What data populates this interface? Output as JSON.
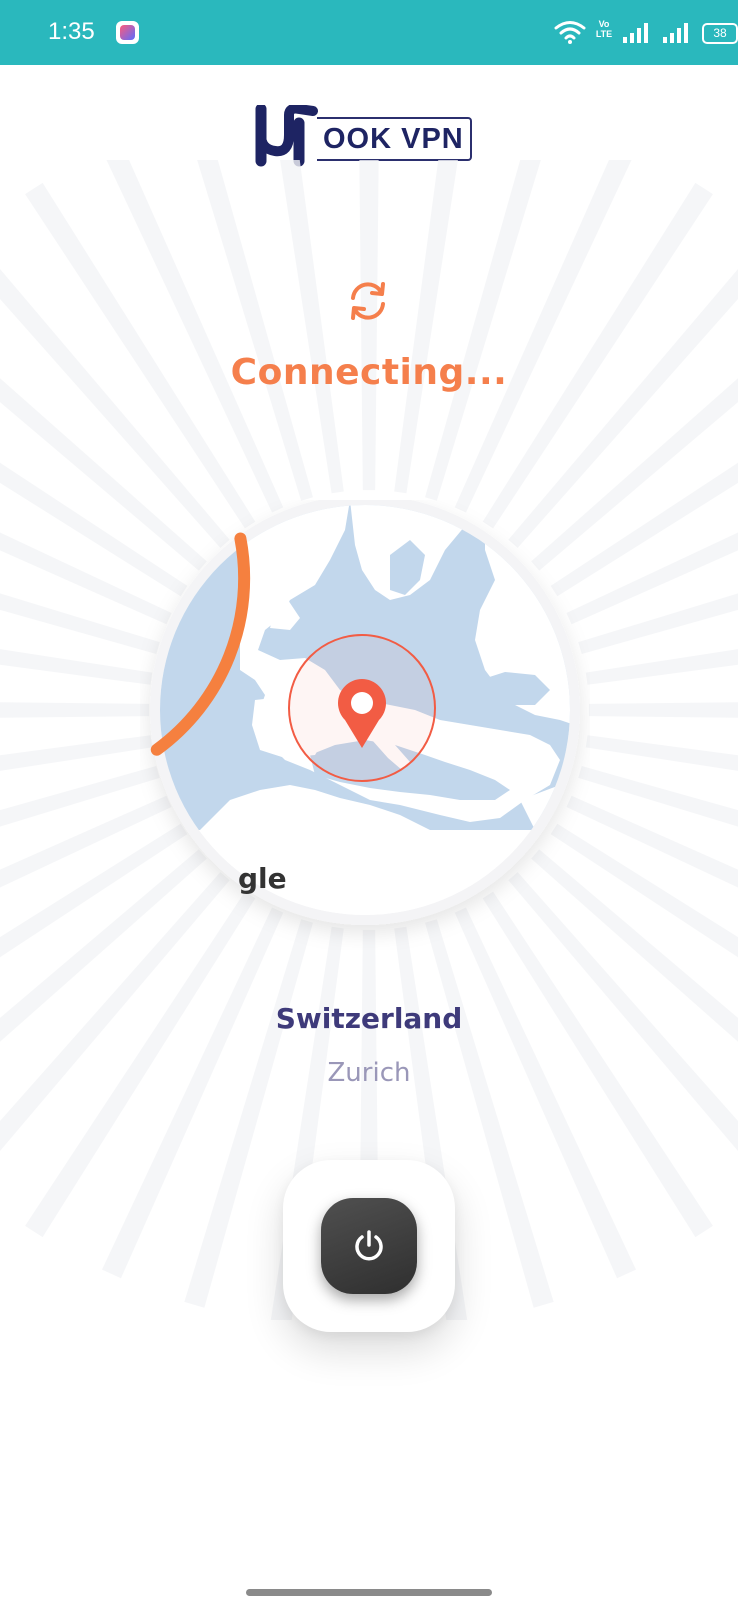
{
  "status_bar": {
    "time": "1:35",
    "volte_line1": "Vo",
    "volte_line2": "LTE",
    "battery": "38",
    "bg_color": "#2ab8bd"
  },
  "logo": {
    "text": "OOK VPN"
  },
  "connection": {
    "status": "Connecting...",
    "status_icon": "sync-icon",
    "accent_color": "#f57f4c"
  },
  "map": {
    "progress_fraction": 0.18,
    "pin_color": "#f25c44",
    "land_color": "#c2d7ec"
  },
  "location": {
    "country": "Switzerland",
    "city": "Zurich"
  },
  "power": {
    "icon": "power-icon"
  }
}
